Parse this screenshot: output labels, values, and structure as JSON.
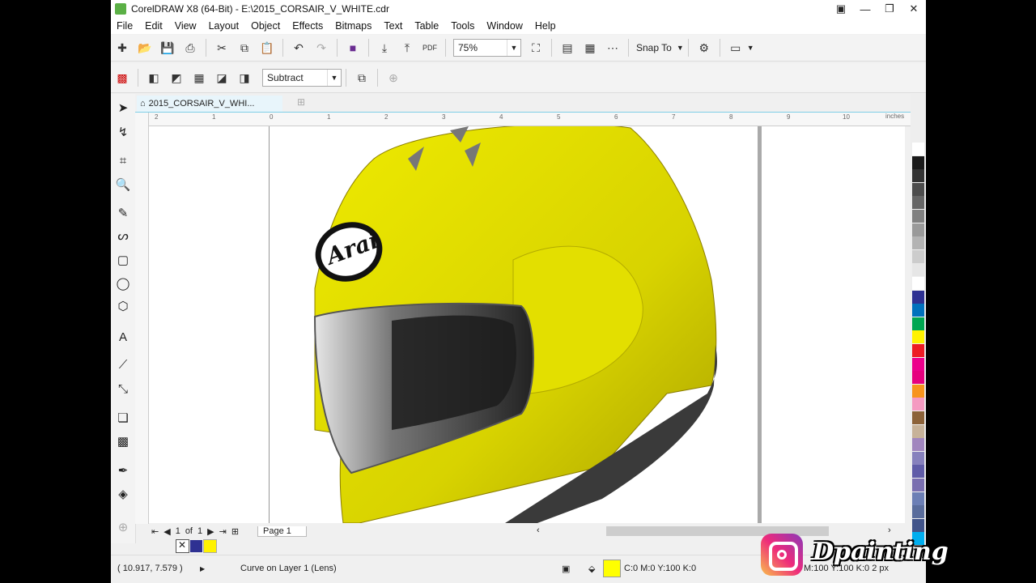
{
  "window": {
    "title": "CorelDRAW X8 (64-Bit) - E:\\2015_CORSAIR_V_WHITE.cdr"
  },
  "menu": [
    "File",
    "Edit",
    "View",
    "Layout",
    "Object",
    "Effects",
    "Bitmaps",
    "Text",
    "Table",
    "Tools",
    "Window",
    "Help"
  ],
  "toolbar": {
    "zoom": "75%",
    "snap_label": "Snap To"
  },
  "property_bar": {
    "mode": "Subtract"
  },
  "document_tab": {
    "label": "2015_CORSAIR_V_WHI..."
  },
  "ruler": {
    "unit": "inches",
    "h_numbers": [
      "2",
      "1",
      "0",
      "1",
      "2",
      "3",
      "4",
      "5",
      "6",
      "7",
      "8",
      "9",
      "10"
    ]
  },
  "page_nav": {
    "current": "1",
    "of_label": "of",
    "total": "1",
    "page_tab": "Page 1"
  },
  "status": {
    "coords": "( 10.917, 7.579 )",
    "object_info": "Curve on Layer 1  (Lens)",
    "fill_info": "C:0 M:0 Y:100 K:0",
    "outline_info": "M:100 Y:100 K:0  2 px"
  },
  "logo": {
    "brand_text": "Arai"
  },
  "watermark": {
    "text": "Dpainting"
  },
  "colors": {
    "fill": "#ffff00",
    "helmet": "#d9d400",
    "accent": "#7fcfe6"
  },
  "palette": [
    "#ffffff",
    "#1a1a1a",
    "#333333",
    "#4d4d4d",
    "#666666",
    "#808080",
    "#999999",
    "#b3b3b3",
    "#cccccc",
    "#e6e6e6",
    "#ffffff",
    "#2e3192",
    "#0071bc",
    "#00a651",
    "#fff200",
    "#ed1c24",
    "#ec008c",
    "#e6007e",
    "#f7941d",
    "#f49ac1",
    "#8c6239",
    "#c7b299",
    "#a186be",
    "#8781bd",
    "#605ca8",
    "#7a6fb0",
    "#6c7fb5",
    "#5a6d9c",
    "#41548a",
    "#00aeef"
  ]
}
